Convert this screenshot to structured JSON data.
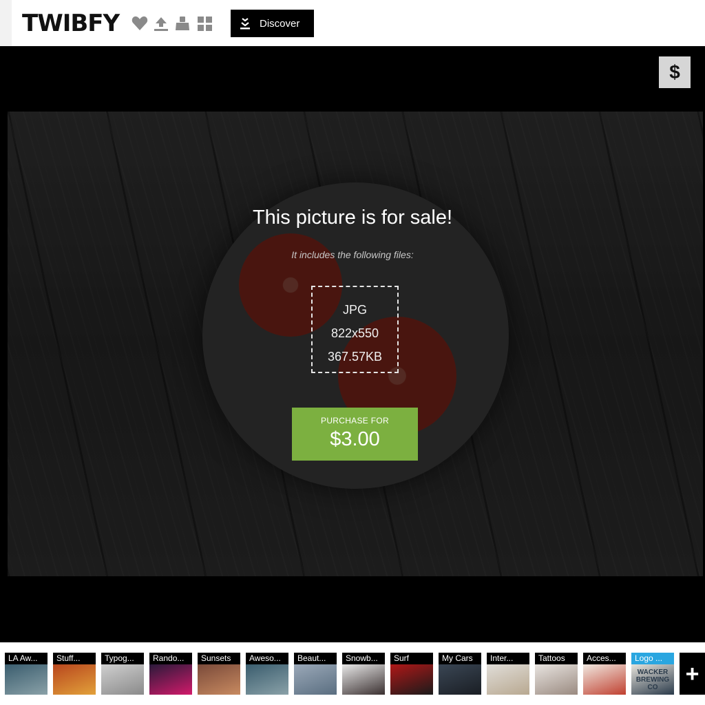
{
  "header": {
    "logo_text": "TWIBFY",
    "icons": [
      "heart-icon",
      "upload-icon",
      "stamp-icon",
      "grid-icon"
    ],
    "discover_label": "Discover"
  },
  "sale_button": {
    "symbol": "$"
  },
  "sale": {
    "title": "This picture is for sale!",
    "subtitle": "It includes the following files:",
    "file_type": "JPG",
    "file_dimensions": "822x550",
    "file_size": "367.57KB",
    "purchase_label": "PURCHASE FOR",
    "price": "$3.00"
  },
  "collections": [
    {
      "label": "LA Aw...",
      "colors": [
        "#3a5d6e",
        "#8aa1a8"
      ]
    },
    {
      "label": "Stuff...",
      "colors": [
        "#b8461e",
        "#e2a13a"
      ]
    },
    {
      "label": "Typog...",
      "colors": [
        "#cfcfcf",
        "#8a8a8a"
      ]
    },
    {
      "label": "Rando...",
      "colors": [
        "#2a1a3a",
        "#d21a6a"
      ]
    },
    {
      "label": "Sunsets",
      "colors": [
        "#7a4a3a",
        "#c88a60"
      ]
    },
    {
      "label": "Aweso...",
      "colors": [
        "#3a5d6e",
        "#8aa1a8"
      ]
    },
    {
      "label": "Beaut...",
      "colors": [
        "#9aa8b8",
        "#5a6e80"
      ]
    },
    {
      "label": "Snowb...",
      "colors": [
        "#e8e8e8",
        "#3a3030"
      ]
    },
    {
      "label": "Surf",
      "colors": [
        "#b01818",
        "#1a1a1a"
      ]
    },
    {
      "label": "My Cars",
      "colors": [
        "#3a4654",
        "#1a1e24"
      ]
    },
    {
      "label": "Inter...",
      "colors": [
        "#e0ddd8",
        "#b8a890"
      ]
    },
    {
      "label": "Tattoos",
      "colors": [
        "#e8e4e0",
        "#9a8a80"
      ]
    },
    {
      "label": "Acces...",
      "colors": [
        "#f0e8e0",
        "#c04030"
      ]
    },
    {
      "label": "Logo ...",
      "colors": [
        "#e8e4dc",
        "#2a3a4a"
      ],
      "highlight": "#2aa6e0",
      "thumb_text": "WACKER BREWING CO"
    }
  ],
  "more_symbol": "+"
}
